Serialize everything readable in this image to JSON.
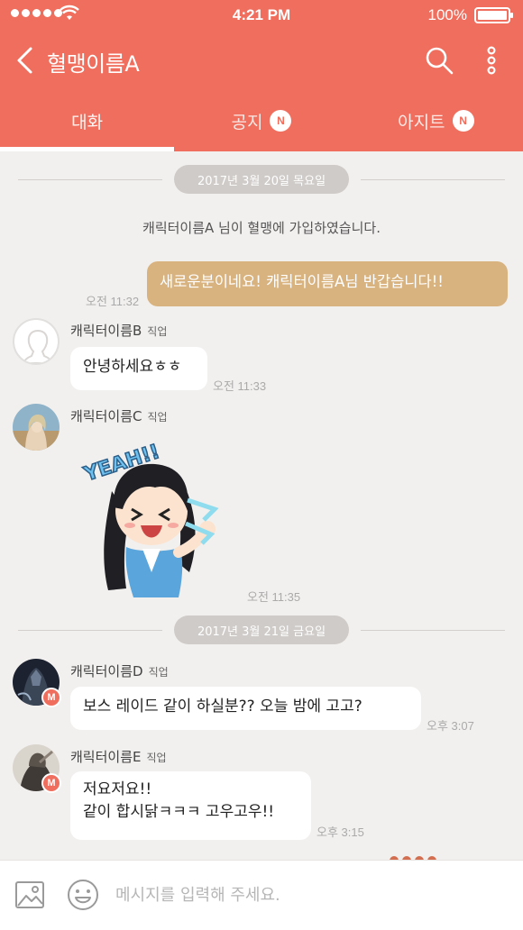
{
  "status": {
    "time": "4:21 PM",
    "battery": "100%"
  },
  "header": {
    "title": "혈맹이름A"
  },
  "tabs": [
    {
      "label": "대화",
      "active": true,
      "badge": ""
    },
    {
      "label": "공지",
      "active": false,
      "badge": "N"
    },
    {
      "label": "아지트",
      "active": false,
      "badge": "N"
    }
  ],
  "chat": {
    "date1": "2017년 3월 20일 목요일",
    "system": "캐릭터이름A 님이 혈맹에 가입하였습니다.",
    "my_message": {
      "text": "새로운분이네요! 캐릭터이름A님 반갑습니다!!",
      "time": "오전 11:32"
    },
    "msg_b": {
      "name": "캐릭터이름B",
      "job": "직업",
      "text": "안녕하세요ㅎㅎ",
      "time": "오전 11:33"
    },
    "msg_c": {
      "name": "캐릭터이름C",
      "job": "직업",
      "sticker_text": "YEAH!!",
      "time": "오전 11:35"
    },
    "date2": "2017년 3월 21일 금요일",
    "msg_d": {
      "name": "캐릭터이름D",
      "job": "직업",
      "text": "보스 레이드 같이 하실분?? 오늘 밤에 고고?",
      "time": "오후 3:07",
      "badge": "M"
    },
    "msg_e": {
      "name": "캐릭터이름E",
      "job": "직업",
      "line1": "저요저요!!",
      "line2": "같이 합시닭ㅋㅋㅋ 고우고우!!",
      "time": "오후 3:15",
      "badge": "M"
    }
  },
  "input": {
    "placeholder": "메시지를 입력해 주세요."
  },
  "colors": {
    "accent": "#f06e5d",
    "my_bubble": "#d8b27f",
    "background": "#f2f0ee"
  }
}
